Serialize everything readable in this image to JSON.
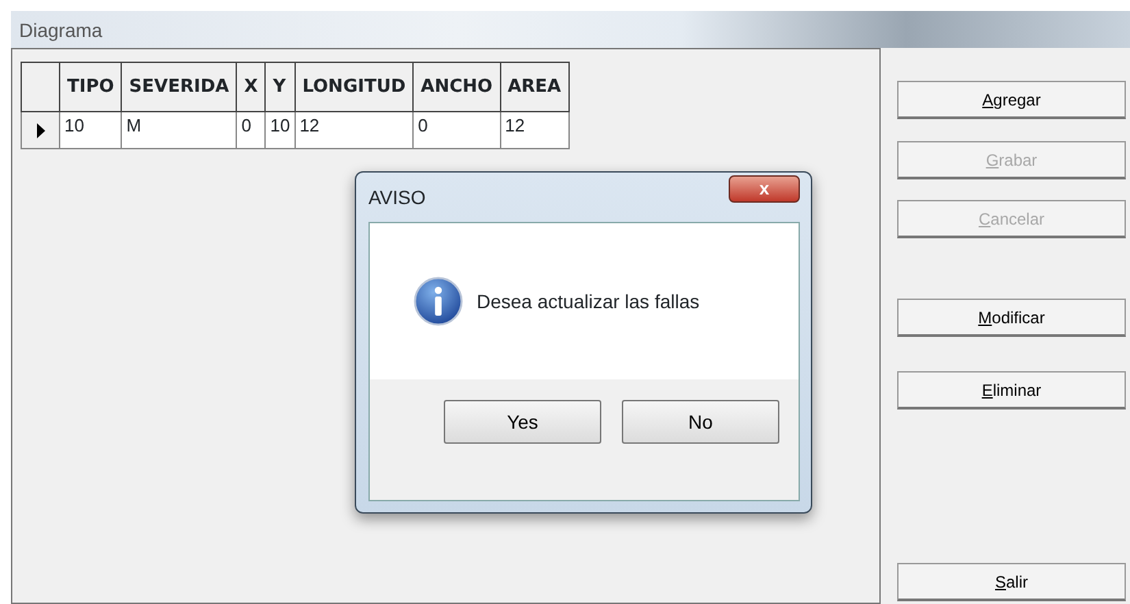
{
  "window": {
    "title": "Diagrama"
  },
  "table": {
    "columns": [
      "TIPO",
      "SEVERIDA",
      "X",
      "Y",
      "LONGITUD",
      "ANCHO",
      "AREA"
    ],
    "rows": [
      {
        "selected": true,
        "cells": [
          "10",
          "M",
          "0",
          "10",
          "12",
          "0",
          "12"
        ]
      }
    ]
  },
  "buttons": [
    {
      "label": "Agregar",
      "disabled": false
    },
    {
      "label": "Grabar",
      "disabled": true
    },
    {
      "label": "Cancelar",
      "disabled": true
    },
    {
      "label": "Modificar",
      "disabled": false
    },
    {
      "label": "Eliminar",
      "disabled": false
    },
    {
      "label": "Salir",
      "disabled": false
    }
  ],
  "dialog": {
    "title": "AVISO",
    "close": "x",
    "message": "Desea actualizar las fallas",
    "buttons": [
      "Yes",
      "No"
    ]
  }
}
